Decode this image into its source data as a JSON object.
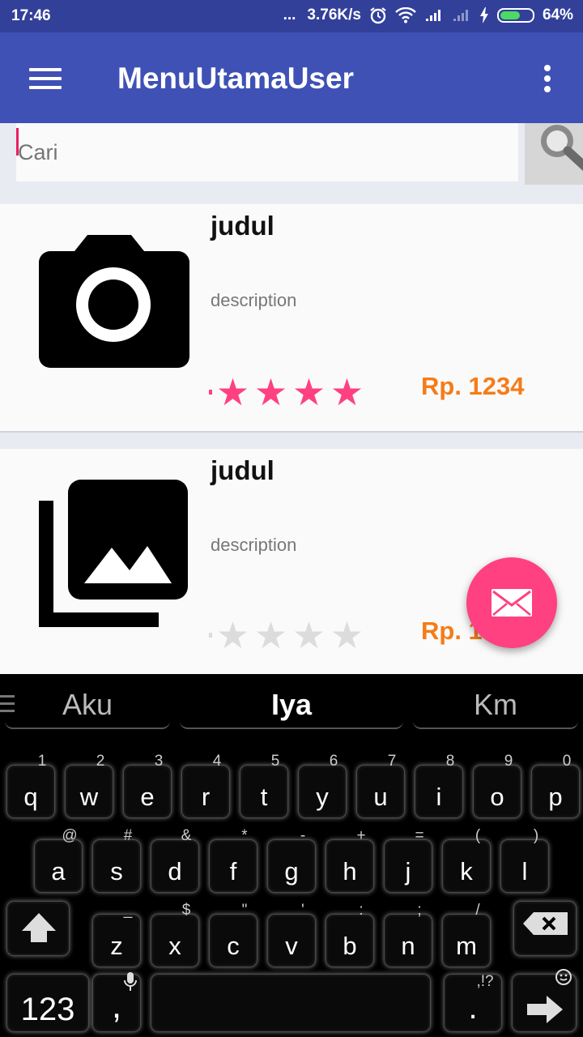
{
  "status_bar": {
    "time": "17:46",
    "dots": "...",
    "network_speed": "3.76K/s",
    "battery_percent": "64%",
    "battery_level": 0.64,
    "icons": [
      "alarm-icon",
      "wifi-icon",
      "signal-icon",
      "signal-icon",
      "charging-icon",
      "battery-icon"
    ]
  },
  "app_bar": {
    "title": "MenuUtamaUser",
    "icons": [
      "hamburger-menu-icon",
      "overflow-menu-icon"
    ]
  },
  "search": {
    "placeholder": "Cari",
    "button_icon": "magnifier-icon"
  },
  "items": [
    {
      "title": "judul",
      "description": "description",
      "rating": 5,
      "max_rating": 5,
      "price": "Rp. 1234",
      "icon": "camera-icon"
    },
    {
      "title": "judul",
      "description": "description",
      "rating": 0,
      "max_rating": 5,
      "price": "Rp. 1",
      "icon": "image-gallery-icon"
    }
  ],
  "fab": {
    "icon": "mail-icon"
  },
  "colors": {
    "primary": "#3f51b5",
    "primary_dark": "#32409a",
    "accent": "#ff4081",
    "price": "#f57c18",
    "star_filled": "#ff4081",
    "star_empty": "#dcdcdc"
  },
  "keyboard": {
    "suggestions": [
      "Aku",
      "Iya",
      "Km"
    ],
    "row1": [
      {
        "key": "q",
        "sub": "1"
      },
      {
        "key": "w",
        "sub": "2"
      },
      {
        "key": "e",
        "sub": "3"
      },
      {
        "key": "r",
        "sub": "4"
      },
      {
        "key": "t",
        "sub": "5"
      },
      {
        "key": "y",
        "sub": "6"
      },
      {
        "key": "u",
        "sub": "7"
      },
      {
        "key": "i",
        "sub": "8"
      },
      {
        "key": "o",
        "sub": "9"
      },
      {
        "key": "p",
        "sub": "0"
      }
    ],
    "row2": [
      {
        "key": "a",
        "sub": "@"
      },
      {
        "key": "s",
        "sub": "#"
      },
      {
        "key": "d",
        "sub": "&"
      },
      {
        "key": "f",
        "sub": "*"
      },
      {
        "key": "g",
        "sub": "-"
      },
      {
        "key": "h",
        "sub": "+"
      },
      {
        "key": "j",
        "sub": "="
      },
      {
        "key": "k",
        "sub": "("
      },
      {
        "key": "l",
        "sub": ")"
      }
    ],
    "row3": [
      {
        "key": "z",
        "sub": "_"
      },
      {
        "key": "x",
        "sub": "$"
      },
      {
        "key": "c",
        "sub": "\""
      },
      {
        "key": "v",
        "sub": "'"
      },
      {
        "key": "b",
        "sub": ":"
      },
      {
        "key": "n",
        "sub": ";"
      },
      {
        "key": "m",
        "sub": "/"
      }
    ],
    "symbols_label": "123",
    "comma_label": ",",
    "period_label": ".",
    "period_sub": ",!?",
    "icons": [
      "shift-icon",
      "backspace-icon",
      "microphone-icon",
      "emoji-icon",
      "enter-arrow-icon"
    ]
  }
}
